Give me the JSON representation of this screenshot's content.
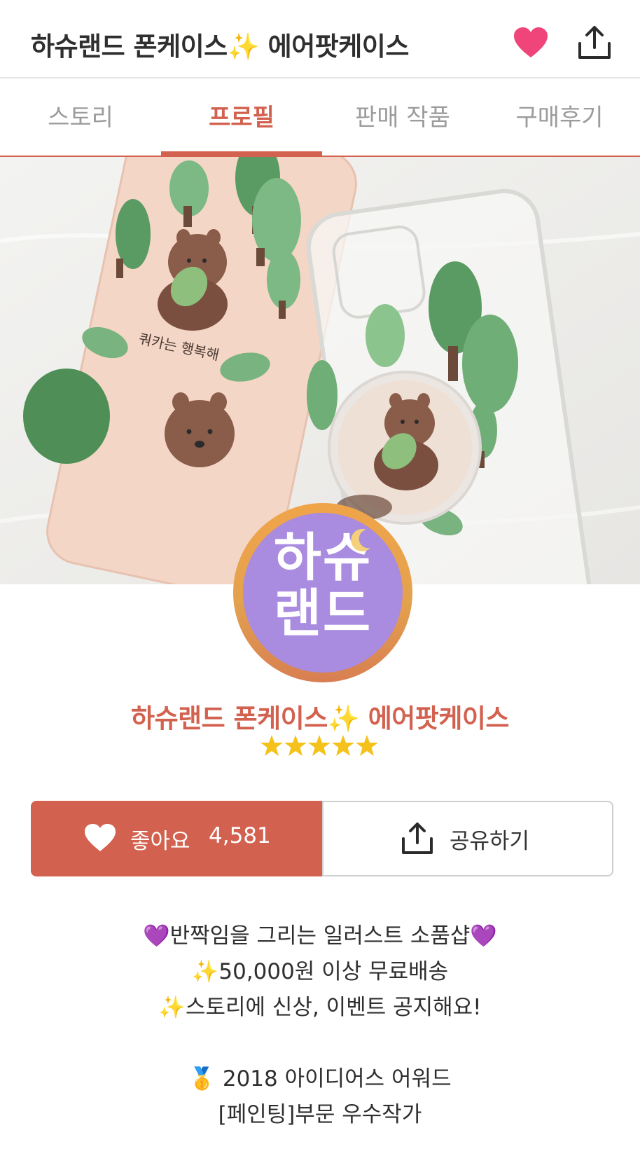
{
  "header": {
    "title": "하슈랜드 폰케이스✨ 에어팟케이스"
  },
  "tabs": [
    {
      "label": "스토리"
    },
    {
      "label": "프로필"
    },
    {
      "label": "판매 작품"
    },
    {
      "label": "구매후기"
    }
  ],
  "active_tab": "프로필",
  "banner": {
    "phone_case_caption": "쿼카는 행복해"
  },
  "avatar": {
    "line1": "하슈",
    "line2": "랜드"
  },
  "shop": {
    "name": "하슈랜드 폰케이스✨ 에어팟케이스",
    "rating_stars": 5
  },
  "actions": {
    "like_label": "좋아요",
    "like_count": "4,581",
    "share_label": "공유하기"
  },
  "description": [
    "💜반짝임을 그리는 일러스트 소품샵💜",
    "✨50,000원 이상 무료배송",
    "✨스토리에 신상, 이벤트 공지해요!",
    "",
    "🥇 2018 아이디어스 어워드",
    "[페인팅]부문 우수작가"
  ],
  "colors": {
    "accent": "#d3614f",
    "heart": "#f0457a",
    "star": "#f5c21b",
    "avatar_bg": "#a98be0"
  }
}
